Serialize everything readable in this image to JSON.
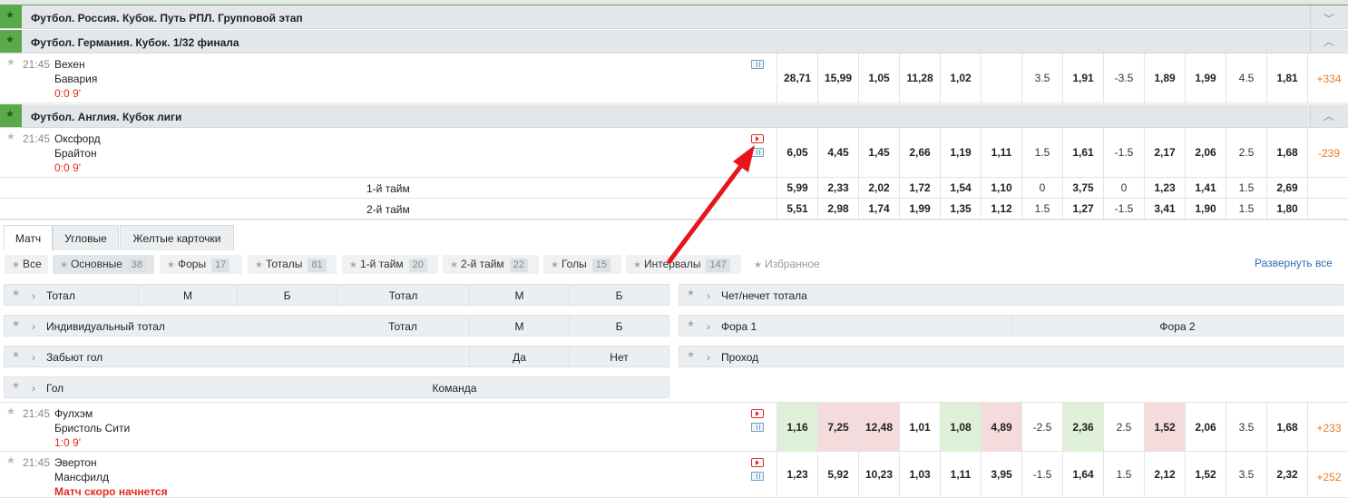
{
  "leagues": [
    {
      "name": "Футбол. Россия. Кубок. Путь РПЛ. Групповой этап"
    },
    {
      "name": "Футбол. Германия. Кубок. 1/32 финала"
    },
    {
      "name": "Футбол. Англия. Кубок лиги"
    }
  ],
  "matches": [
    {
      "time": "21:45",
      "team1": "Вехен",
      "team2": "Бавария",
      "score": "0:0 9'",
      "odds": [
        "28,71",
        "15,99",
        "1,05",
        "11,28",
        "1,02",
        "",
        "3.5",
        "1,91",
        "-3.5",
        "1,89",
        "1,99",
        "4.5",
        "1,81"
      ],
      "plus": "+334"
    },
    {
      "time": "21:45",
      "team1": "Оксфорд",
      "team2": "Брайтон",
      "score": "0:0 9'",
      "odds": [
        "6,05",
        "4,45",
        "1,45",
        "2,66",
        "1,19",
        "1,11",
        "1.5",
        "1,61",
        "-1.5",
        "2,17",
        "2,06",
        "2.5",
        "1,68"
      ],
      "plus": "-239",
      "halves": [
        {
          "label": "1-й тайм",
          "odds": [
            "5,99",
            "2,33",
            "2,02",
            "1,72",
            "1,54",
            "1,10",
            "0",
            "3,75",
            "0",
            "1,23",
            "1,41",
            "1.5",
            "2,69"
          ]
        },
        {
          "label": "2-й тайм",
          "odds": [
            "5,51",
            "2,98",
            "1,74",
            "1,99",
            "1,35",
            "1,12",
            "1.5",
            "1,27",
            "-1.5",
            "3,41",
            "1,90",
            "1.5",
            "1,80"
          ]
        }
      ]
    },
    {
      "time": "21:45",
      "team1": "Фулхэм",
      "team2": "Бристоль Сити",
      "score": "1:0 9'",
      "odds": [
        "1,16",
        "7,25",
        "12,48",
        "1,01",
        "1,08",
        "4,89",
        "-2.5",
        "2,36",
        "2.5",
        "1,52",
        "2,06",
        "3.5",
        "1,68"
      ],
      "plus": "+233"
    },
    {
      "time": "21:45",
      "team1": "Эвертон",
      "team2": "Мансфилд",
      "score": "Матч скоро начнется",
      "odds": [
        "1,23",
        "5,92",
        "10,23",
        "1,03",
        "1,11",
        "3,95",
        "-1.5",
        "1,64",
        "1.5",
        "2,12",
        "1,52",
        "3.5",
        "2,32"
      ],
      "plus": "+252"
    }
  ],
  "tabs": [
    "Матч",
    "Угловые",
    "Желтые карточки"
  ],
  "chips": [
    {
      "label": "Все",
      "count": ""
    },
    {
      "label": "Основные",
      "count": "38"
    },
    {
      "label": "Форы",
      "count": "17"
    },
    {
      "label": "Тоталы",
      "count": "81"
    },
    {
      "label": "1-й тайм",
      "count": "20"
    },
    {
      "label": "2-й тайм",
      "count": "22"
    },
    {
      "label": "Голы",
      "count": "15"
    },
    {
      "label": "Интервалы",
      "count": "147"
    },
    {
      "label": "Избранное",
      "count": ""
    }
  ],
  "expand_all": "Развернуть все",
  "markets_left": [
    {
      "label": "Тотал",
      "cols": [
        "М",
        "Б",
        "Тотал",
        "М",
        "Б"
      ]
    },
    {
      "label": "Индивидуальный тотал",
      "cols": [
        "Тотал",
        "М",
        "Б"
      ]
    },
    {
      "label": "Забьют гол",
      "cols": [
        "Да",
        "Нет"
      ]
    },
    {
      "label": "Гол",
      "cols": [
        "Команда"
      ]
    }
  ],
  "markets_right": [
    {
      "label": "Чет/нечет тотала",
      "cols": []
    },
    {
      "label": "Фора 1",
      "cols": [
        "Фора 2"
      ]
    },
    {
      "label": "Проход",
      "cols": []
    }
  ],
  "colors": {
    "green": "#5aa94a",
    "red": "#e32a1e",
    "orange": "#e67b24",
    "link": "#2a6fb0"
  }
}
